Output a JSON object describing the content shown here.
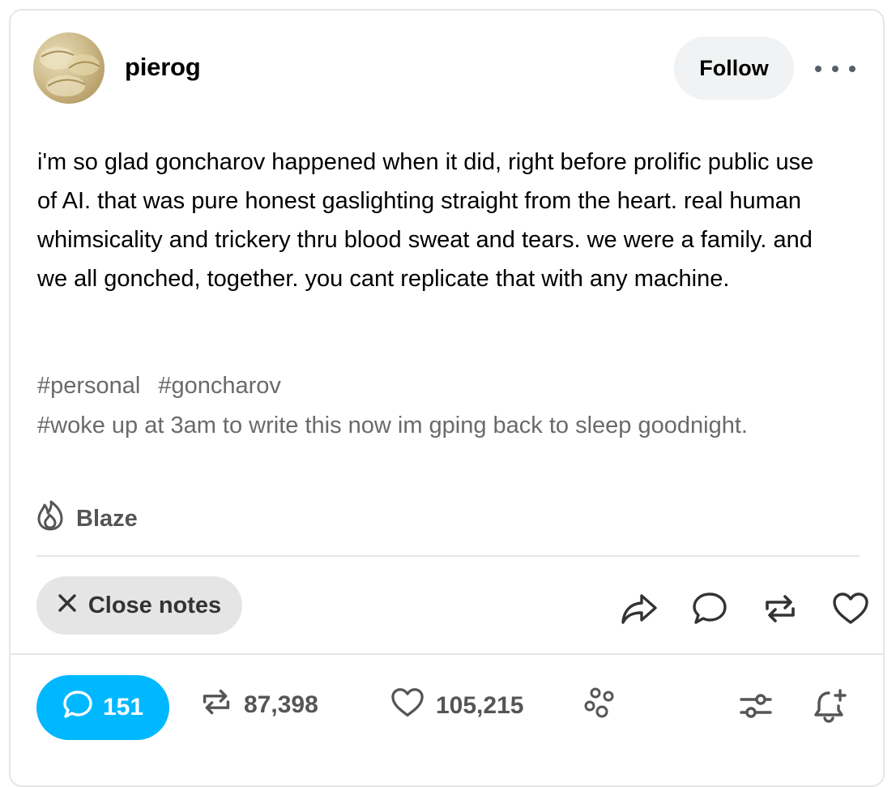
{
  "post": {
    "username": "pierog",
    "follow_label": "Follow",
    "body": "i'm so glad goncharov happened when it did, right before prolific public use of AI. that was pure honest gaslighting straight from the heart. real human whimsicality and trickery thru blood sweat and tears. we were a family. and we all gonched, together. you cant replicate that with any machine.",
    "tags": [
      "#personal",
      "#goncharov",
      "#woke up at 3am to write this now im gping back to sleep goodnight."
    ]
  },
  "blaze": {
    "label": "Blaze",
    "icon": "flame-icon"
  },
  "footer": {
    "close_notes_label": "Close notes",
    "actions": [
      "share-icon",
      "reply-icon",
      "reblog-icon",
      "like-icon"
    ]
  },
  "notes": {
    "replies": "151",
    "reblogs": "87,398",
    "likes": "105,215"
  },
  "colors": {
    "accent_blue": "#00b8ff",
    "follow_bg": "#f1f2f3",
    "tag_gray": "#6a6a6a"
  }
}
